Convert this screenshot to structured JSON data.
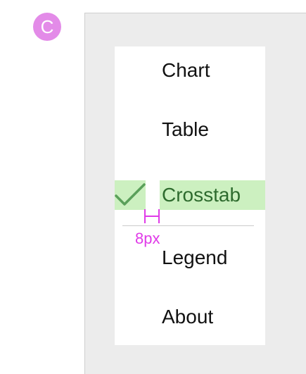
{
  "badge": {
    "letter": "C",
    "color": "#e38be8"
  },
  "menu": {
    "items": [
      {
        "label": "Chart",
        "checked": false
      },
      {
        "label": "Table",
        "checked": false
      },
      {
        "label": "Crosstab",
        "checked": true,
        "icon": "check-icon"
      },
      {
        "label": "Legend",
        "checked": false
      },
      {
        "label": "About",
        "checked": false
      }
    ]
  },
  "annotation": {
    "spacing_label": "8px",
    "color": "#e03be8"
  },
  "colors": {
    "highlight": "#ccf0c0",
    "check": "#5aa05a",
    "panel": "#ececec",
    "menu_background": "#ffffff"
  }
}
